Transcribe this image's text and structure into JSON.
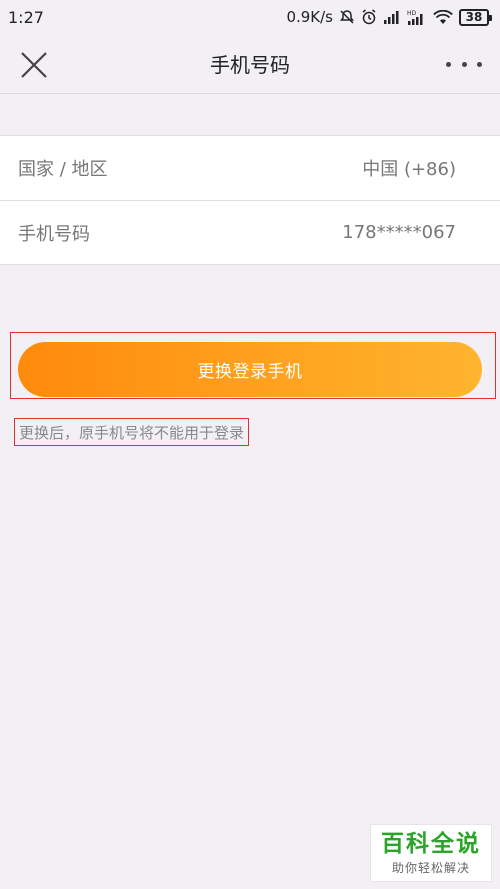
{
  "status": {
    "time": "1:27",
    "speed": "0.9K/s",
    "signal_badge": "HD",
    "battery": "38"
  },
  "nav": {
    "title": "手机号码"
  },
  "info": {
    "rows": [
      {
        "label": "国家 / 地区",
        "value": "中国 (+86)"
      },
      {
        "label": "手机号码",
        "value": "178*****067"
      }
    ]
  },
  "action": {
    "button_label": "更换登录手机",
    "hint": "更换后，原手机号将不能用于登录"
  },
  "watermark": {
    "logo": "百科全说",
    "tagline": "助你轻松解决"
  },
  "colors": {
    "button_start": "#ff8a0b",
    "button_end": "#ffb52f",
    "highlight_box": "#dd3333",
    "watermark_green": "#2aa52a"
  }
}
